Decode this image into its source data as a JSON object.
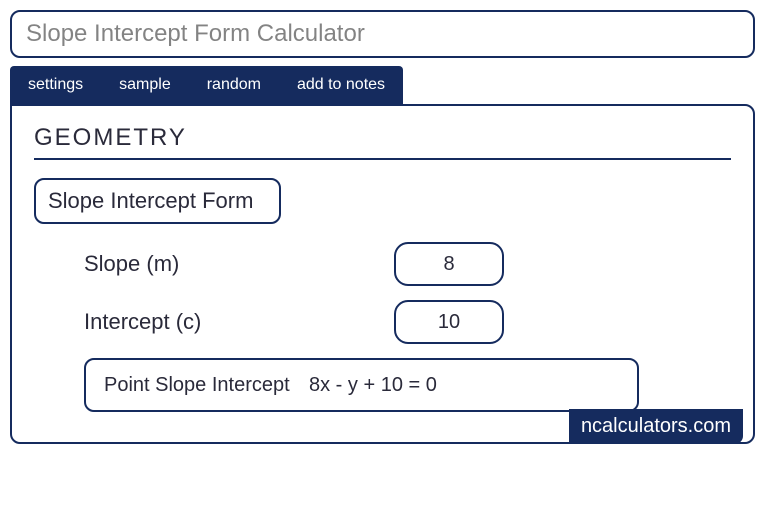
{
  "title": "Slope Intercept Form Calculator",
  "tabs": {
    "settings": "settings",
    "sample": "sample",
    "random": "random",
    "add_to_notes": "add to notes"
  },
  "section": "GEOMETRY",
  "subtitle": "Slope Intercept Form",
  "inputs": {
    "slope_label": "Slope (m)",
    "slope_value": "8",
    "intercept_label": "Intercept (c)",
    "intercept_value": "10"
  },
  "result": {
    "label": "Point Slope Intercept",
    "value": "8x - y + 10 = 0"
  },
  "badge": "ncalculators.com"
}
